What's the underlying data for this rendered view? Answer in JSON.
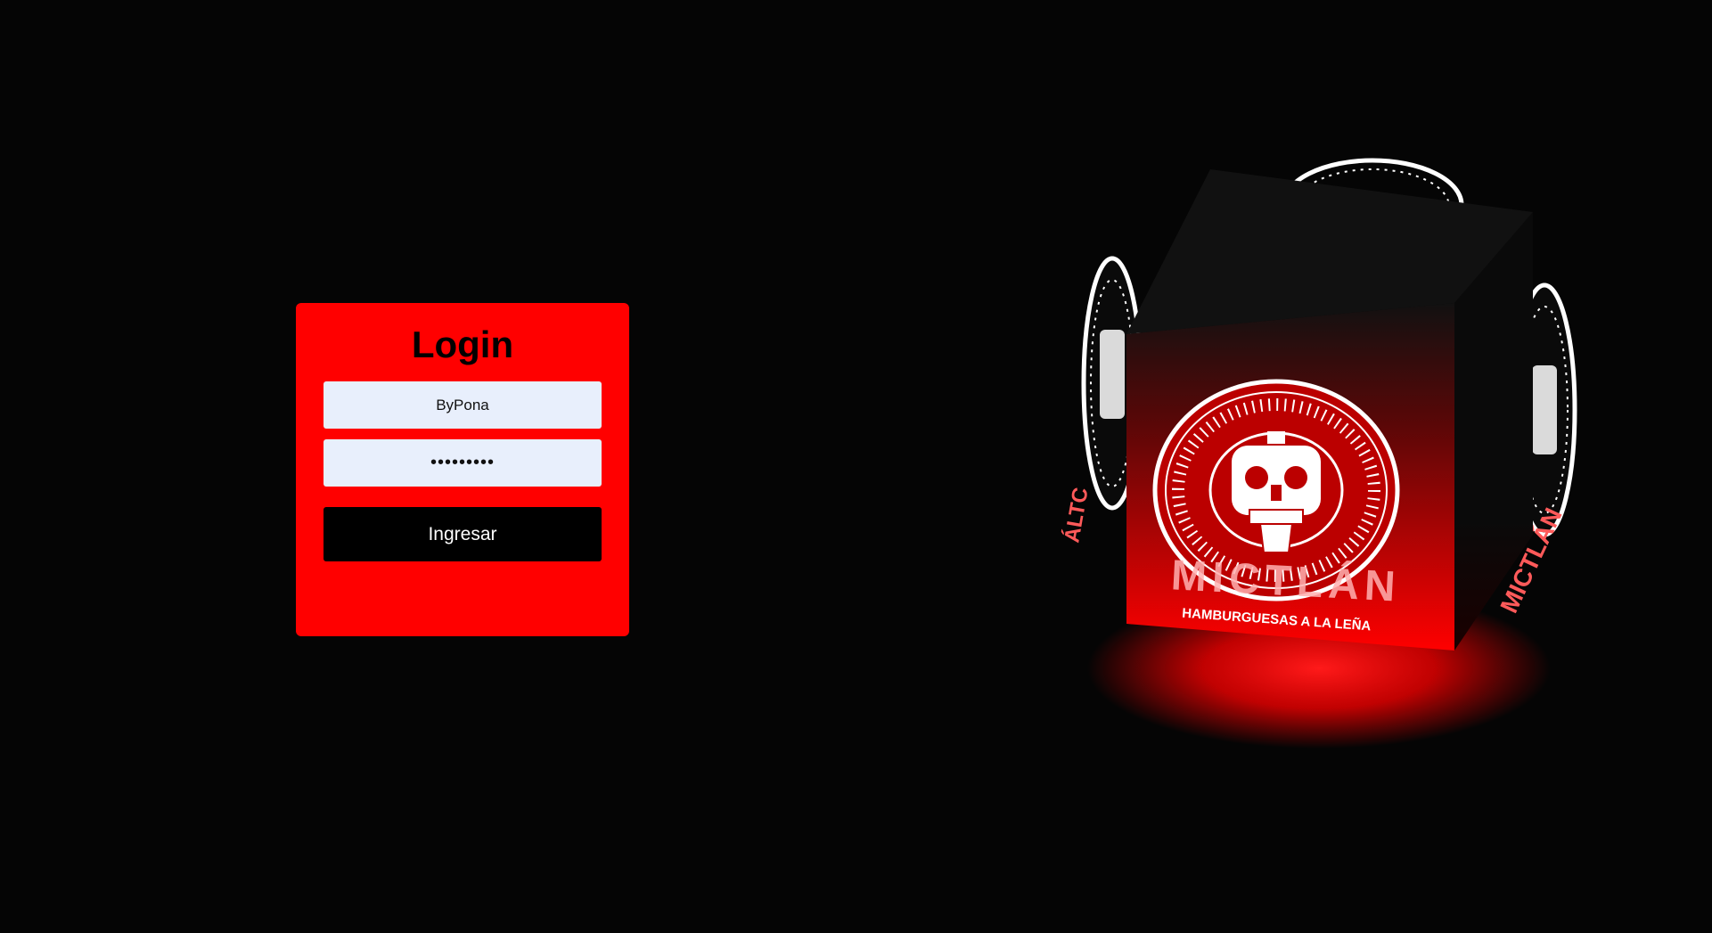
{
  "login": {
    "title": "Login",
    "username_value": "ByPona",
    "password_value": "•••••••••",
    "submit_label": "Ingresar"
  },
  "logo": {
    "brand": "MICTLÁN",
    "tagline": "HAMBURGUESAS A LA LEÑA",
    "icon": "aztec-skull-emblem"
  },
  "colors": {
    "background": "#050505",
    "card": "#ff0000",
    "field": "#e8effc",
    "button": "#000000",
    "glow": "#ff0000"
  }
}
